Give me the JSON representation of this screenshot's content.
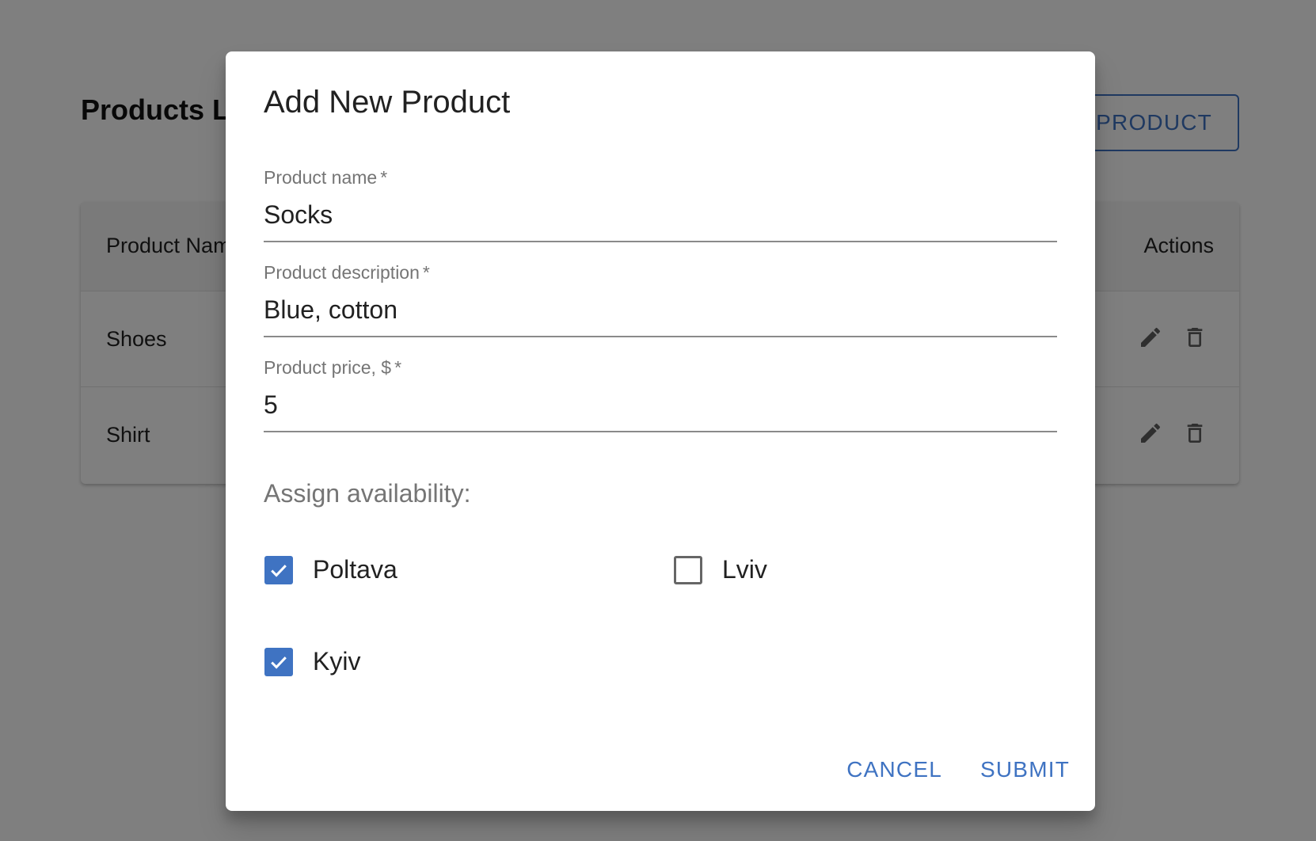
{
  "page": {
    "title": "Products List",
    "add_button_label": "ADD PRODUCT"
  },
  "table": {
    "columns": {
      "name": "Product Name",
      "actions": "Actions"
    },
    "rows": [
      {
        "name": "Shoes"
      },
      {
        "name": "Shirt"
      }
    ]
  },
  "dialog": {
    "title": "Add New Product",
    "fields": {
      "name": {
        "label": "Product name",
        "required_mark": "*",
        "value": "Socks"
      },
      "description": {
        "label": "Product description",
        "required_mark": "*",
        "value": "Blue, cotton"
      },
      "price": {
        "label": "Product price, $",
        "required_mark": "*",
        "value": "5"
      }
    },
    "availability_label": "Assign availability:",
    "locations": [
      {
        "label": "Poltava",
        "checked": true
      },
      {
        "label": "Lviv",
        "checked": false
      },
      {
        "label": "Kyiv",
        "checked": true
      }
    ],
    "cancel_label": "CANCEL",
    "submit_label": "SUBMIT"
  },
  "colors": {
    "accent": "#3f73c2",
    "backdrop": "rgba(0,0,0,0.5)"
  },
  "icons": {
    "edit": "pencil-icon",
    "delete": "trash-icon",
    "check": "check-icon"
  }
}
